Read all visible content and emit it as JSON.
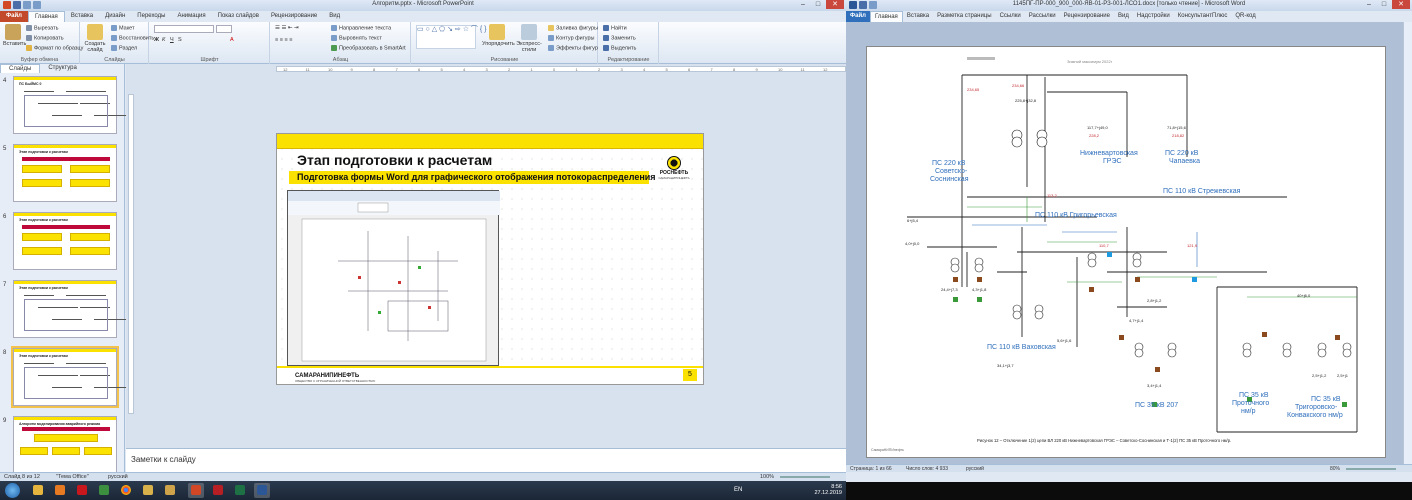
{
  "ppt": {
    "window_title": "Алгоритм.pptx - Microsoft PowerPoint",
    "tabs": [
      "Файл",
      "Главная",
      "Вставка",
      "Дизайн",
      "Переходы",
      "Анимация",
      "Показ слайдов",
      "Рецензирование",
      "Вид"
    ],
    "ribbon": {
      "clipboard": {
        "paste": "Вставить",
        "cut": "Вырезать",
        "copy": "Копировать",
        "format_painter": "Формат по образцу",
        "label": "Буфер обмена"
      },
      "slides": {
        "new_slide": "Создать слайд",
        "layout": "Макет",
        "reset": "Восстановить",
        "section": "Раздел",
        "label": "Слайды"
      },
      "font": {
        "label": "Шрифт"
      },
      "paragraph": {
        "text_direction": "Направление текста",
        "align_text": "Выровнять текст",
        "smartart": "Преобразовать в SmartArt",
        "label": "Абзац"
      },
      "drawing": {
        "arrange": "Упорядочить",
        "quick_styles": "Экспресс-стили",
        "fill": "Заливка фигуры",
        "outline": "Контур фигуры",
        "effects": "Эффекты фигур",
        "label": "Рисование"
      },
      "editing": {
        "find": "Найти",
        "replace": "Заменить",
        "select": "Выделить",
        "label": "Редактирование"
      }
    },
    "panel_tabs": [
      "Слайды",
      "Структура"
    ],
    "thumbnails": [
      {
        "num": "4",
        "title": "ПС БыЙМС 0"
      },
      {
        "num": "5",
        "title": "Этап подготовки к расчетам"
      },
      {
        "num": "6",
        "title": "Этап подготовки к расчетам"
      },
      {
        "num": "7",
        "title": "Этап подготовки к расчетам"
      },
      {
        "num": "8",
        "title": "Этап подготовки к расчетам"
      },
      {
        "num": "9",
        "title": "Алгоритм моделирования аварийного режима"
      }
    ],
    "ruler_marks": [
      "12",
      "11",
      "10",
      "9",
      "8",
      "7",
      "6",
      "5",
      "4",
      "3",
      "2",
      "1",
      "0",
      "1",
      "2",
      "3",
      "4",
      "5",
      "6",
      "7",
      "8",
      "9",
      "10",
      "11",
      "12"
    ],
    "slide": {
      "title": "Этап подготовки к расчетам",
      "subtitle": "Подготовка формы Word для графического отображения потокораспределения",
      "logo_name": "РОСНЕФТЬ",
      "logo_sub": "САМАРАНИПИНЕФТЬ",
      "bottom_name": "САМАРАНИПИНЕФТЬ",
      "bottom_sub": "ОБЩЕСТВО С ОГРАНИЧЕННОЙ ОТВЕТСТВЕННОСТЬЮ",
      "page_number": "5"
    },
    "notes_placeholder": "Заметки к слайду",
    "status": {
      "slide": "Слайд 8 из 12",
      "theme": "\"Тема Office\"",
      "lang": "русский",
      "zoom": "100%"
    }
  },
  "taskbar": {
    "lang": "EN",
    "time": "8:56",
    "date": "27.12.2019"
  },
  "word": {
    "window_title": "1145ПГ-ПР-000_900_000-ЯВ-01-РЗ-001-ЛСО1.docx [только чтение] - Microsoft Word",
    "tabs": [
      "Файл",
      "Главная",
      "Вставка",
      "Разметка страницы",
      "Ссылки",
      "Рассылки",
      "Рецензирование",
      "Вид",
      "Надстройки",
      "КонсультантПлюс",
      "QR-код"
    ],
    "schematic": {
      "header": "Зимний максимум 2022г",
      "labels": {
        "ps220_sov": [
          "ПС 220 кВ",
          "Советско-",
          "Соснинская"
        ],
        "nvgres": [
          "Нижневартовская",
          "ГРЭС"
        ],
        "ps220_chap": [
          "ПС 220 кВ",
          "Чапаевка"
        ],
        "ps110_strezh": "ПС 110 кВ Стрежевская",
        "ps110_grig": "ПС 110 кВ Григорьевская",
        "ps110_vakh": "ПС 110 кВ Ваховская",
        "ps35_207": "ПС 35 кВ 207",
        "ps35_prot": [
          "ПС 35 кВ",
          "Проточного",
          "нм/р"
        ],
        "ps35_trig": [
          "ПС 35 кВ",
          "Тригоровско-",
          "Конвакского нм/р"
        ]
      },
      "values": [
        "234,65",
        "234,66",
        "225,8+j32,8",
        "228,2",
        "218,82",
        "117,7+j49,0",
        "71,8+j15,6",
        "6+j5,4",
        "4,0+j0,0",
        "24,4+j7,3",
        "4,3+j1,8",
        "34,1+j3,7",
        "2,8+j1,2",
        "4,7+j1,4",
        "2,5+j1,2",
        "40+j6,0",
        "3,4+j1,4",
        "5,6+j1,6",
        "2,5+j1",
        "113,2",
        "110,7",
        "121,9"
      ],
      "caption": "Рисунок 12 – Отключение 1(2) цепи ВЛ 220 кВ Нижневартовская ГРЭС – Советско-Соснинская и Т-1(2) ПС 35 кВ Проточного нм/р.",
      "footer": "СамараНИПИнефть"
    },
    "status": {
      "page": "Страница: 1 из 66",
      "words": "Число слов: 4 933",
      "lang": "русский",
      "zoom": "80%"
    }
  }
}
